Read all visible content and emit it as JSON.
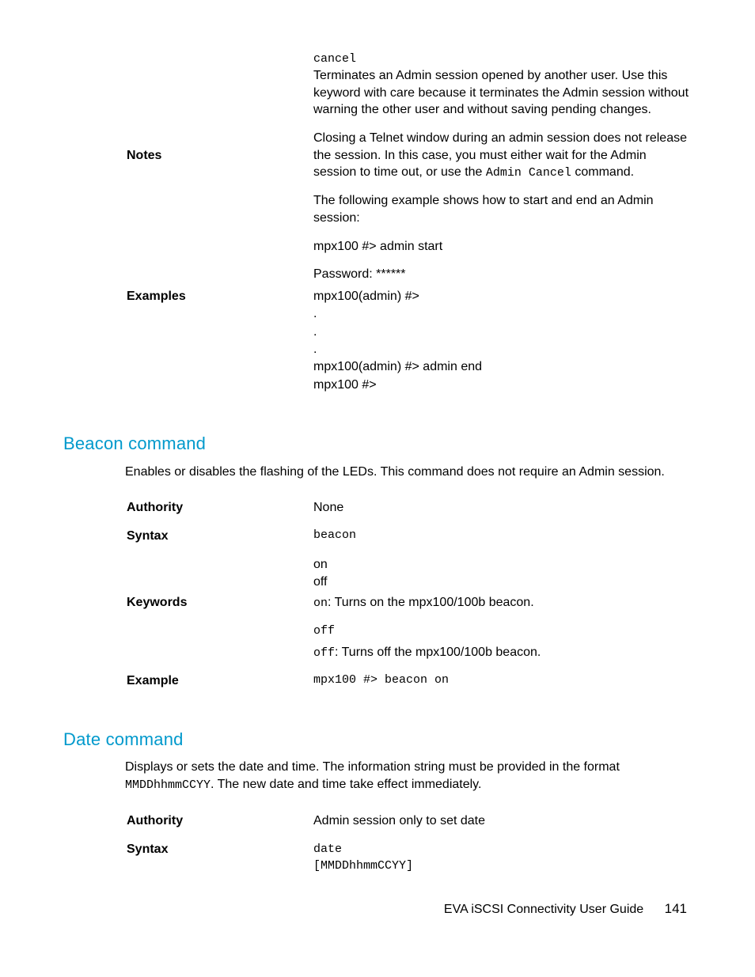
{
  "top": {
    "cancel_keyword": "cancel",
    "cancel_desc": "Terminates an Admin session opened by another user. Use this keyword with care because it terminates the Admin session without warning the other user and without saving pending changes.",
    "notes_label": "Notes",
    "notes_text_pre": "Closing a Telnet window during an admin session does not release the session. In this case, you must either wait for the Admin session to time out, or use the ",
    "notes_cmd": "Admin Cancel",
    "notes_text_post": " command.",
    "example_intro": "The following example shows how to start and end an Admin session:",
    "examples_label": "Examples",
    "ex_l1": "mpx100 #> admin start",
    "ex_l2": "Password: ******",
    "ex_l3": "mpx100(admin) #>",
    "dot": ".",
    "ex_l4": "mpx100(admin) #> admin end",
    "ex_l5": "mpx100 #>"
  },
  "beacon": {
    "heading": "Beacon command",
    "intro": "Enables or disables the flashing of the LEDs. This command does not require an Admin session.",
    "authority_label": "Authority",
    "authority_value": "None",
    "syntax_label": "Syntax",
    "syntax_value": "beacon",
    "keywords_label": "Keywords",
    "kw_on": "on",
    "kw_off": "off",
    "on_code": "on",
    "on_desc": ": Turns on the mpx100/100b beacon.",
    "off_code1": "off",
    "off_code2": "off",
    "off_desc": ": Turns off the mpx100/100b beacon.",
    "example_label": "Example",
    "example_value": "mpx100 #> beacon on"
  },
  "date": {
    "heading": "Date command",
    "intro_pre": "Displays or sets the date and time. The information string must be provided in the format ",
    "intro_code": "MMDDhhmmCCYY",
    "intro_post": ". The new date and time take effect immediately.",
    "authority_label": "Authority",
    "authority_value": "Admin session only to set date",
    "syntax_label": "Syntax",
    "syntax_l1": "date",
    "syntax_l2": "[MMDDhhmmCCYY]"
  },
  "footer": {
    "title": "EVA iSCSI Connectivity User Guide",
    "page": "141"
  }
}
